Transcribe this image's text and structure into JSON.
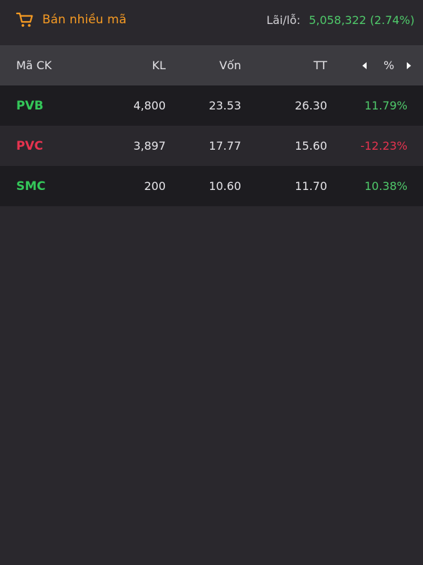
{
  "header": {
    "sell_multi_label": "Bán nhiều mã",
    "pnl_label": "Lãi/lỗ:",
    "pnl_value": "5,058,322 (2.74%)"
  },
  "colors": {
    "accent": "#f59a23",
    "gain": "#34c759",
    "loss": "#e6334f",
    "background": "#2a282d",
    "header_bg": "#3c3b40"
  },
  "table": {
    "columns": [
      "Mã CK",
      "KL",
      "Vốn",
      "TT",
      "%"
    ],
    "rows": [
      {
        "symbol": "PVB",
        "kl": "4,800",
        "von": "23.53",
        "tt": "26.30",
        "pct": "11.79%",
        "trend": "up"
      },
      {
        "symbol": "PVC",
        "kl": "3,897",
        "von": "17.77",
        "tt": "15.60",
        "pct": "-12.23%",
        "trend": "down"
      },
      {
        "symbol": "SMC",
        "kl": "200",
        "von": "10.60",
        "tt": "11.70",
        "pct": "10.38%",
        "trend": "up"
      }
    ]
  },
  "icons": {
    "cart": "cart-icon",
    "prev": "caret-left-icon",
    "next": "caret-right-icon"
  }
}
